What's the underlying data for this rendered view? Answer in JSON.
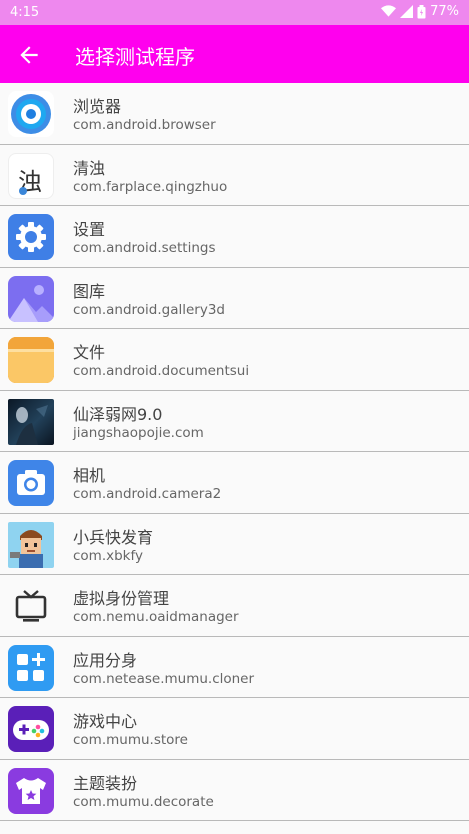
{
  "status": {
    "time": "4:15",
    "battery": "77%"
  },
  "appbar": {
    "title": "选择测试程序"
  },
  "apps": [
    {
      "name": "浏览器",
      "pkg": "com.android.browser",
      "icon": "browser-icon"
    },
    {
      "name": "清浊",
      "pkg": "com.farplace.qingzhuo",
      "icon": "qingzhuo-icon",
      "icon_text": "浊"
    },
    {
      "name": "设置",
      "pkg": "com.android.settings",
      "icon": "settings-gear-icon"
    },
    {
      "name": "图库",
      "pkg": "com.android.gallery3d",
      "icon": "gallery-icon"
    },
    {
      "name": "文件",
      "pkg": "com.android.documentsui",
      "icon": "folder-icon"
    },
    {
      "name": "仙泽弱网9.0",
      "pkg": "jiangshaopojie.com",
      "icon": "xianze-icon"
    },
    {
      "name": "相机",
      "pkg": "com.android.camera2",
      "icon": "camera-icon"
    },
    {
      "name": "小兵快发育",
      "pkg": "com.xbkfy",
      "icon": "soldier-icon"
    },
    {
      "name": "虚拟身份管理",
      "pkg": "com.nemu.oaidmanager",
      "icon": "tv-icon"
    },
    {
      "name": "应用分身",
      "pkg": "com.netease.mumu.cloner",
      "icon": "cloner-icon"
    },
    {
      "name": "游戏中心",
      "pkg": "com.mumu.store",
      "icon": "gamepad-icon"
    },
    {
      "name": "主题装扮",
      "pkg": "com.mumu.decorate",
      "icon": "tshirt-icon"
    }
  ]
}
